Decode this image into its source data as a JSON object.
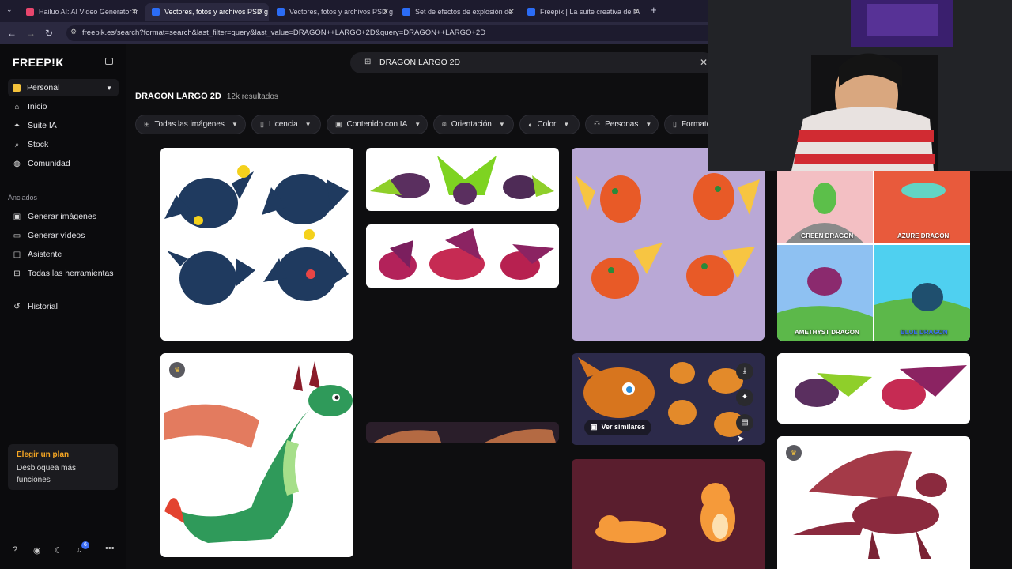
{
  "browser": {
    "tabs": [
      {
        "title": "Hailuo AI: AI Video Generator fr",
        "active": false,
        "favicon_color": "#e8466d"
      },
      {
        "title": "Vectores, fotos y archivos PSD g",
        "active": true,
        "favicon_color": "#2b6cf5"
      },
      {
        "title": "Vectores, fotos y archivos PSD g",
        "active": false,
        "favicon_color": "#2b6cf5"
      },
      {
        "title": "Set de efectos de explosión de",
        "active": false,
        "favicon_color": "#2b6cf5"
      },
      {
        "title": "Freepik | La suite creativa de IA",
        "active": false,
        "favicon_color": "#2b6cf5"
      }
    ],
    "new_tab": "+",
    "url": "freepik.es/search?format=search&last_filter=query&last_value=DRAGON++LARGO+2D&query=DRAGON++LARGO+2D"
  },
  "sidebar": {
    "logo": "FREEP!K",
    "workspace": "Personal",
    "nav": [
      {
        "label": "Inicio",
        "icon": "home-icon",
        "glyph": "⌂"
      },
      {
        "label": "Suite IA",
        "icon": "sparkle-icon",
        "glyph": "✦"
      },
      {
        "label": "Stock",
        "icon": "search-icon",
        "glyph": "⌕"
      },
      {
        "label": "Comunidad",
        "icon": "globe-icon",
        "glyph": "◍"
      }
    ],
    "pinned_title": "Anclados",
    "pinned": [
      {
        "label": "Generar imágenes",
        "icon": "image-icon",
        "glyph": "▣"
      },
      {
        "label": "Generar vídeos",
        "icon": "video-icon",
        "glyph": "▭"
      },
      {
        "label": "Asistente",
        "icon": "assistant-icon",
        "glyph": "◫"
      },
      {
        "label": "Todas las herramientas",
        "icon": "grid-icon",
        "glyph": "⊞"
      }
    ],
    "history": {
      "label": "Historial",
      "icon": "history-icon",
      "glyph": "↺"
    },
    "plan": {
      "title": "Elegir un plan",
      "text": "Desbloquea más funciones"
    },
    "notifications_count": "6"
  },
  "search": {
    "query": "DRAGON  LARGO 2D"
  },
  "results": {
    "title": "DRAGON LARGO 2D",
    "count": "12k resultados"
  },
  "filters": [
    {
      "label": "Todas las imágenes",
      "icon": "grid-icon",
      "glyph": "⊞"
    },
    {
      "label": "Licencia",
      "icon": "license-icon",
      "glyph": "▯"
    },
    {
      "label": "Contenido con IA",
      "icon": "ai-content-icon",
      "glyph": "▣"
    },
    {
      "label": "Orientación",
      "icon": "orientation-icon",
      "glyph": "⧈"
    },
    {
      "label": "Color",
      "icon": "palette-icon",
      "glyph": "◐"
    },
    {
      "label": "Personas",
      "icon": "people-icon",
      "glyph": "⚇"
    },
    {
      "label": "Formato",
      "icon": "file-icon",
      "glyph": "▯"
    }
  ],
  "captions": {
    "green": "GREEN DRAGON",
    "azure": "AZURE DRAGON",
    "amethyst": "AMETHYST DRAGON",
    "blue": "BLUE DRAGON"
  },
  "card_actions": {
    "similar": "Ver similares"
  },
  "colors": {
    "accent": "#f5a623",
    "background": "#0e0e10",
    "sidebar": "#0b0b0d",
    "chip": "#1f1f24"
  }
}
